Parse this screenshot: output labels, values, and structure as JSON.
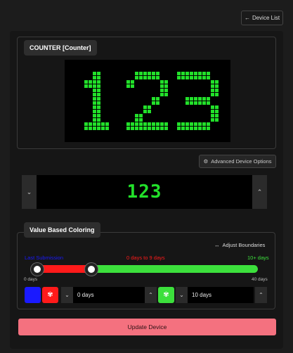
{
  "header": {
    "device_list_label": "Device List"
  },
  "counter": {
    "title": "COUNTER [Counter]",
    "display_value": "123",
    "led_color": "#22e02a",
    "led_off_color": "#000000"
  },
  "advanced_options_label": "Advanced Device Options",
  "value_control": {
    "value": "123",
    "decrement_icon": "chevron-down",
    "increment_icon": "chevron-up"
  },
  "value_based_coloring": {
    "title": "Value Based Coloring",
    "adjust_label": "Adjust Boundaries",
    "ranges": [
      {
        "label": "Last Submission",
        "color": "#1a1aff"
      },
      {
        "label": "0 days to 9 days",
        "color": "#ff1a1a"
      },
      {
        "label": "10+ days",
        "color": "#3ce03c"
      }
    ],
    "slider": {
      "min_label": "0 days",
      "max_label": "40 days",
      "min": 0,
      "max": 40,
      "thumb_values": [
        0,
        10
      ]
    },
    "lower": {
      "swatch_color": "#1a1aff",
      "next_swatch_color": "#ff1a1a",
      "value": "0 days"
    },
    "upper": {
      "swatch_color": "#3ce03c",
      "value": "10 days"
    }
  },
  "update_label": "Update Device"
}
